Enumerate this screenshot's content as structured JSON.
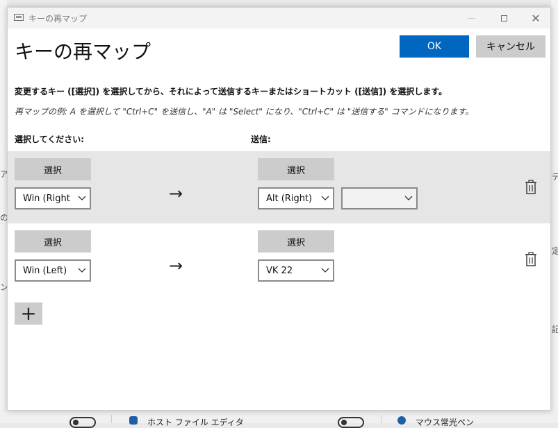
{
  "window": {
    "title": "キーの再マップ"
  },
  "dialog": {
    "heading": "キーの再マップ",
    "ok_label": "OK",
    "cancel_label": "キャンセル",
    "instruction": "変更するキー ([選択]) を選択してから、それによって送信するキーまたはショートカット ([送信]) を選択します。",
    "example": "再マップの例: A を選択して \"Ctrl+C\" を送信し、\"A\" は \"Select\" になり、\"Ctrl+C\" は \"送信する\" コマンドになります。",
    "select_column_label": "選択してください:",
    "send_column_label": "送信:"
  },
  "mappings": [
    {
      "select_button": "選択",
      "original_key": "Win (Right",
      "send_button": "選択",
      "target_key": "Alt (Right)",
      "target_extra": ""
    },
    {
      "select_button": "選択",
      "original_key": "Win (Left)",
      "send_button": "選択",
      "target_key": "VK 22"
    }
  ],
  "icons": {
    "arrow": "→",
    "chevron": "﹀",
    "add": "+",
    "delete": "trash-icon"
  },
  "background": {
    "edge_left": [
      "ア",
      "の",
      "ン"
    ],
    "edge_right": [
      "デ",
      "定",
      "記"
    ],
    "bottom_items": [
      "ホスト ファイル エディタ",
      "マウス常光ペン"
    ]
  },
  "colors": {
    "accent": "#0067c0",
    "button_gray": "#cccccc",
    "row_highlight": "#e6e6e6"
  }
}
